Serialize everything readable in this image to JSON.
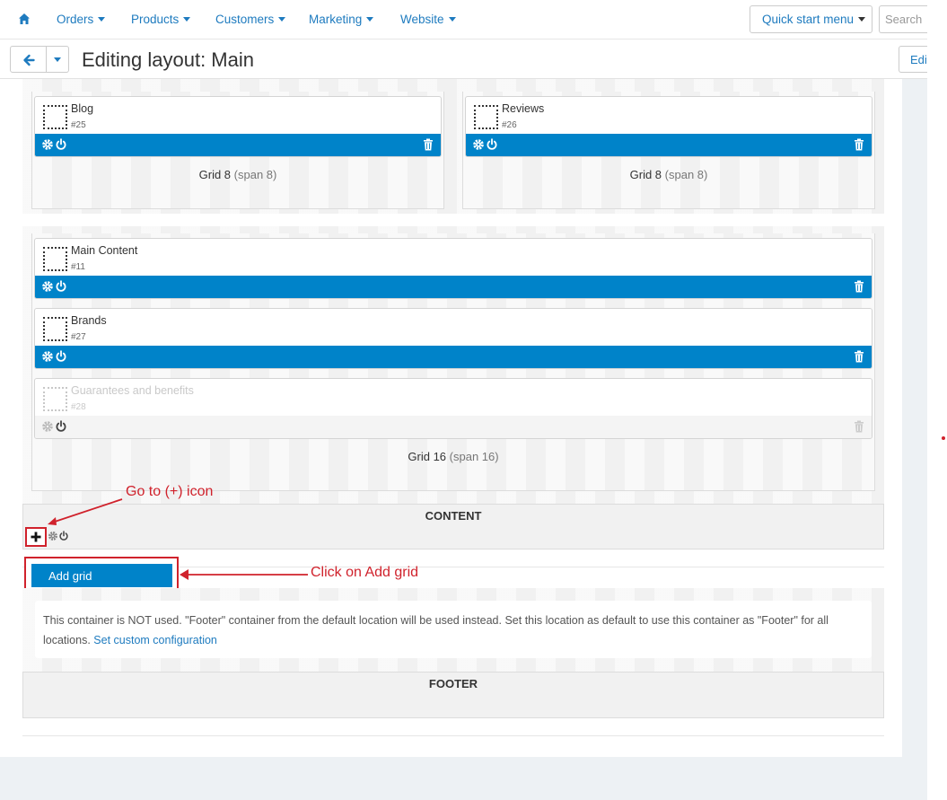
{
  "nav": {
    "items": [
      {
        "label": "Orders"
      },
      {
        "label": "Products"
      },
      {
        "label": "Customers"
      },
      {
        "label": "Marketing"
      },
      {
        "label": "Website"
      }
    ],
    "quick_start": "Quick start menu",
    "search_placeholder": "Search"
  },
  "header": {
    "title": "Editing layout: Main",
    "edit_button": "Edit"
  },
  "grids": [
    {
      "label": "Grid 8",
      "span": "(span 8)",
      "blocks": [
        {
          "name": "Blog",
          "id": "#25"
        }
      ]
    },
    {
      "label": "Grid 8",
      "span": "(span 8)",
      "blocks": [
        {
          "name": "Reviews",
          "id": "#26"
        }
      ]
    },
    {
      "label": "Grid 16",
      "span": "(span 16)",
      "blocks": [
        {
          "name": "Main Content",
          "id": "#11"
        },
        {
          "name": "Brands",
          "id": "#27"
        },
        {
          "name": "Guarantees and benefits",
          "id": "#28",
          "disabled": true
        }
      ]
    }
  ],
  "containers": {
    "content": "CONTENT",
    "footer": "FOOTER"
  },
  "add_grid": "Add grid",
  "footer_notice": {
    "text": "This container is NOT used. \"Footer\" container from the default location will be used instead. Set this location as default to use this container as \"Footer\" for all locations.",
    "link": "Set custom configuration"
  },
  "annotations": {
    "goto_plus": "Go to (+) icon",
    "click_add_grid": "Click on Add grid"
  },
  "colors": {
    "accent": "#0083c9",
    "link": "#1e7bbf",
    "annotation": "#d0222c"
  }
}
